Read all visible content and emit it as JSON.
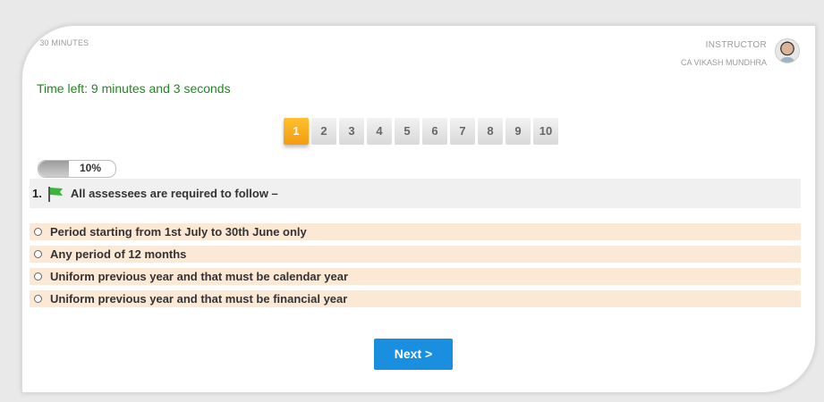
{
  "header": {
    "duration": "30 MINUTES",
    "instructor_role": "INSTRUCTOR",
    "instructor_name": "CA VIKASH MUNDHRA"
  },
  "timer": {
    "text": "Time left: 9 minutes and 3 seconds"
  },
  "pagination": {
    "pages": [
      "1",
      "2",
      "3",
      "4",
      "5",
      "6",
      "7",
      "8",
      "9",
      "10"
    ],
    "active_page": "1"
  },
  "progress": {
    "label": "10%",
    "fraction": 0.1
  },
  "question": {
    "number": "1.",
    "text": "All assessees are required to follow –",
    "flag_color": "#3cb43c"
  },
  "options": [
    {
      "label": "Period starting from 1st July to 30th June only"
    },
    {
      "label": "Any period of 12 months"
    },
    {
      "label": "Uniform previous year and that must be calendar year"
    },
    {
      "label": "Uniform previous year and that must be financial year"
    }
  ],
  "navigation": {
    "next_label": "Next >"
  },
  "colors": {
    "timer": "#1f8a1f",
    "active_page": "#f39c12",
    "option_bg": "#fbe9d6",
    "next_button": "#1a8fe0"
  }
}
